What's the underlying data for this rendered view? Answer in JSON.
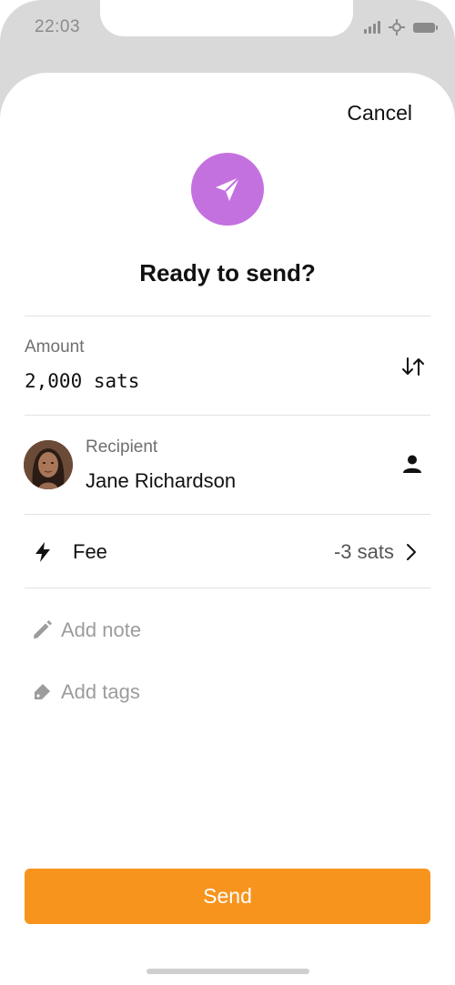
{
  "status_bar": {
    "time": "22:03"
  },
  "header": {
    "cancel_label": "Cancel",
    "title": "Ready to send?",
    "badge_icon": "paper-plane-icon",
    "badge_color": "#c471e0"
  },
  "amount": {
    "label": "Amount",
    "value": "2,000 sats",
    "toggle_icon": "swap-arrows-icon"
  },
  "recipient": {
    "label": "Recipient",
    "name": "Jane Richardson",
    "contact_icon": "person-icon"
  },
  "fee": {
    "label": "Fee",
    "value": "-3 sats",
    "icon": "lightning-bolt-icon"
  },
  "actions": {
    "add_note": "Add note",
    "add_tags": "Add tags"
  },
  "footer": {
    "send_label": "Send",
    "send_color": "#f7941d"
  }
}
